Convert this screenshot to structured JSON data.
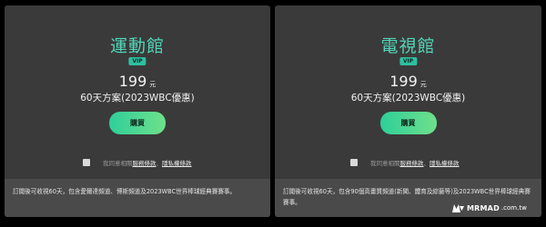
{
  "plans": [
    {
      "title": "運動館",
      "badge": "VIP",
      "price": "199",
      "price_unit": "元",
      "plan_desc": "60天方案(2023WBC優惠)",
      "buy_label": "購買",
      "agree_prefix": "我同意相關",
      "terms_link": "服務條款",
      "separator": "、",
      "privacy_link": "隱私權條款",
      "description": "訂閱後可收視60天，包含愛爾達頻道、博斯頻道及2023WBC世界棒球經典賽賽事。"
    },
    {
      "title": "電視館",
      "badge": "VIP",
      "price": "199",
      "price_unit": "元",
      "plan_desc": "60天方案(2023WBC優惠)",
      "buy_label": "購買",
      "agree_prefix": "我同意相關",
      "terms_link": "服務條款",
      "separator": "、",
      "privacy_link": "隱私權條款",
      "description": "訂閱後可收視60天，包含90個高畫質頻道(新聞、體育及綜藝等)及2023WBC世界棒球經典賽賽事。"
    }
  ],
  "watermark": {
    "brand": "MRMAD",
    "domain": ".com.tw"
  },
  "colors": {
    "accent": "#52d6b8",
    "button_start": "#2ecf9a",
    "button_end": "#6fe08a",
    "card_bg": "#3a3a3a",
    "desc_bg": "#4a4a4a"
  }
}
